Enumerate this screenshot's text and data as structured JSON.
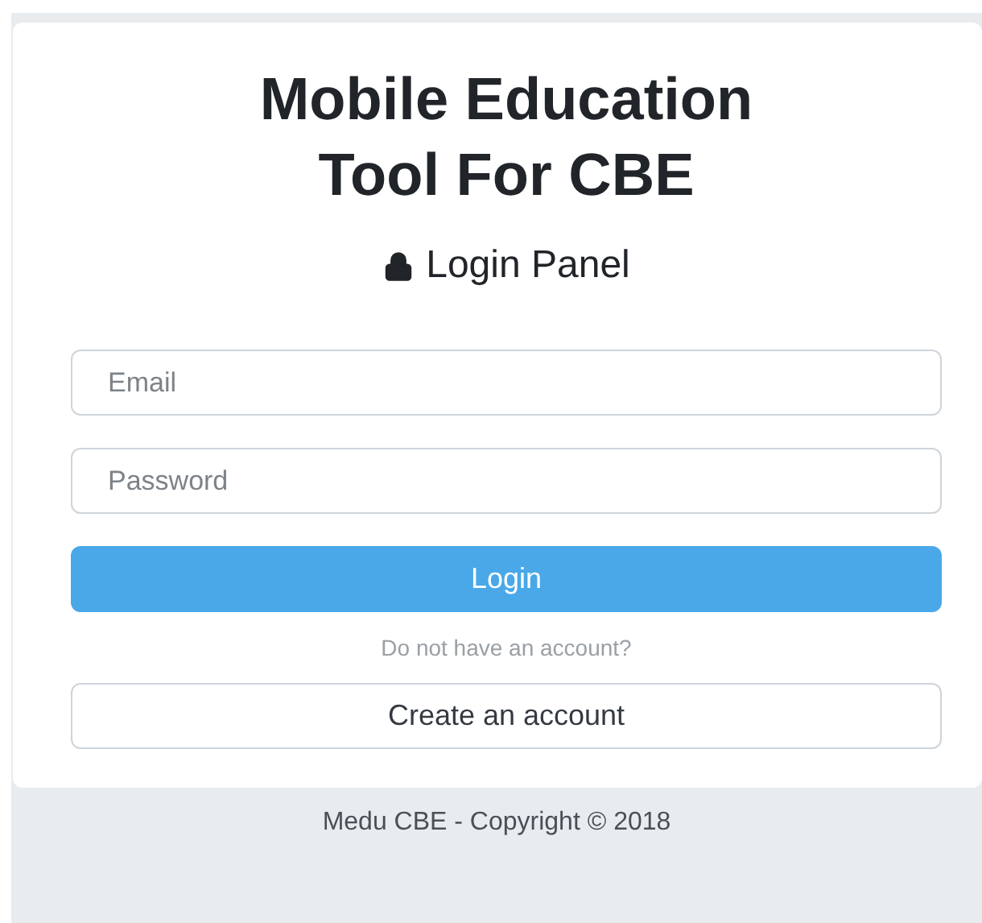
{
  "title": [
    "Mobile Education",
    "Tool For CBE"
  ],
  "panel_title": "Login Panel",
  "fields": [
    {
      "placeholder": "Email"
    },
    {
      "placeholder": "Password"
    }
  ],
  "login_button": "Login",
  "signup_prompt": "Do not have an account?",
  "create_account_button": "Create an account",
  "footer": "Medu CBE - Copyright © 2018"
}
